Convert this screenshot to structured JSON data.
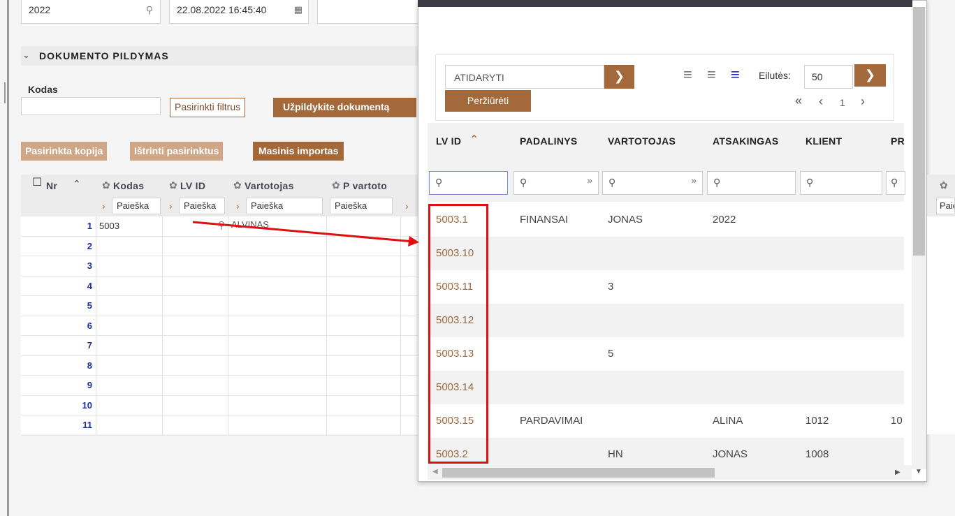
{
  "header": {
    "year_value": "2022",
    "datetime_value": "22.08.2022 16:45:40"
  },
  "section": {
    "title": "DOKUMENTO PILDYMAS",
    "kodas_label": "Kodas",
    "filters_button": "Pasirinkti filtrus",
    "fill_button": "Užpildykite dokumentą"
  },
  "actions": {
    "copy": "Pasirinkta kopija",
    "delete": "Ištrinti pasirinktus",
    "import": "Masinis importas"
  },
  "grid": {
    "columns": [
      "Nr",
      "Kodas",
      "LV ID",
      "Vartotojas",
      "P vartoto"
    ],
    "search_placeholder": "Paieška",
    "rows": [
      {
        "nr": "1",
        "kodas": "5003",
        "lvid": "",
        "vartotojas": "ALVINAS"
      },
      {
        "nr": "2"
      },
      {
        "nr": "3"
      },
      {
        "nr": "4"
      },
      {
        "nr": "5"
      },
      {
        "nr": "6"
      },
      {
        "nr": "7"
      },
      {
        "nr": "8"
      },
      {
        "nr": "9"
      },
      {
        "nr": "10"
      },
      {
        "nr": "11"
      }
    ],
    "right_edge_search": "Paie"
  },
  "popup": {
    "select_value": "ATIDARYTI",
    "view_button": "Peržiūrėti",
    "rows_label": "Eilutės:",
    "rows_value": "50",
    "page_number": "1",
    "columns": [
      "LV ID",
      "PADALINYS",
      "VARTOTOJAS",
      "ATSAKINGAS",
      "KLIENT",
      "PR"
    ],
    "rows": [
      {
        "lvid": "5003.1",
        "padalinys": "FINANSAI",
        "vartotojas": "JONAS",
        "atsakingas": "2022",
        "klient": "",
        "pr": ""
      },
      {
        "lvid": "5003.10",
        "padalinys": "",
        "vartotojas": "",
        "atsakingas": "",
        "klient": "",
        "pr": ""
      },
      {
        "lvid": "5003.11",
        "padalinys": "",
        "vartotojas": "3",
        "atsakingas": "",
        "klient": "",
        "pr": ""
      },
      {
        "lvid": "5003.12",
        "padalinys": "",
        "vartotojas": "",
        "atsakingas": "",
        "klient": "",
        "pr": ""
      },
      {
        "lvid": "5003.13",
        "padalinys": "",
        "vartotojas": "5",
        "atsakingas": "",
        "klient": "",
        "pr": ""
      },
      {
        "lvid": "5003.14",
        "padalinys": "",
        "vartotojas": "",
        "atsakingas": "",
        "klient": "",
        "pr": ""
      },
      {
        "lvid": "5003.15",
        "padalinys": "PARDAVIMAI",
        "vartotojas": "",
        "atsakingas": "ALINA",
        "klient": "1012",
        "pr": "10"
      },
      {
        "lvid": "5003.2",
        "padalinys": "",
        "vartotojas": "HN",
        "atsakingas": "JONAS",
        "klient": "1008",
        "pr": ""
      }
    ]
  },
  "colors": {
    "accent": "#a4693a",
    "accent_light": "#cfa787",
    "highlight": "#e01010",
    "row_number": "#1a2f9c"
  }
}
